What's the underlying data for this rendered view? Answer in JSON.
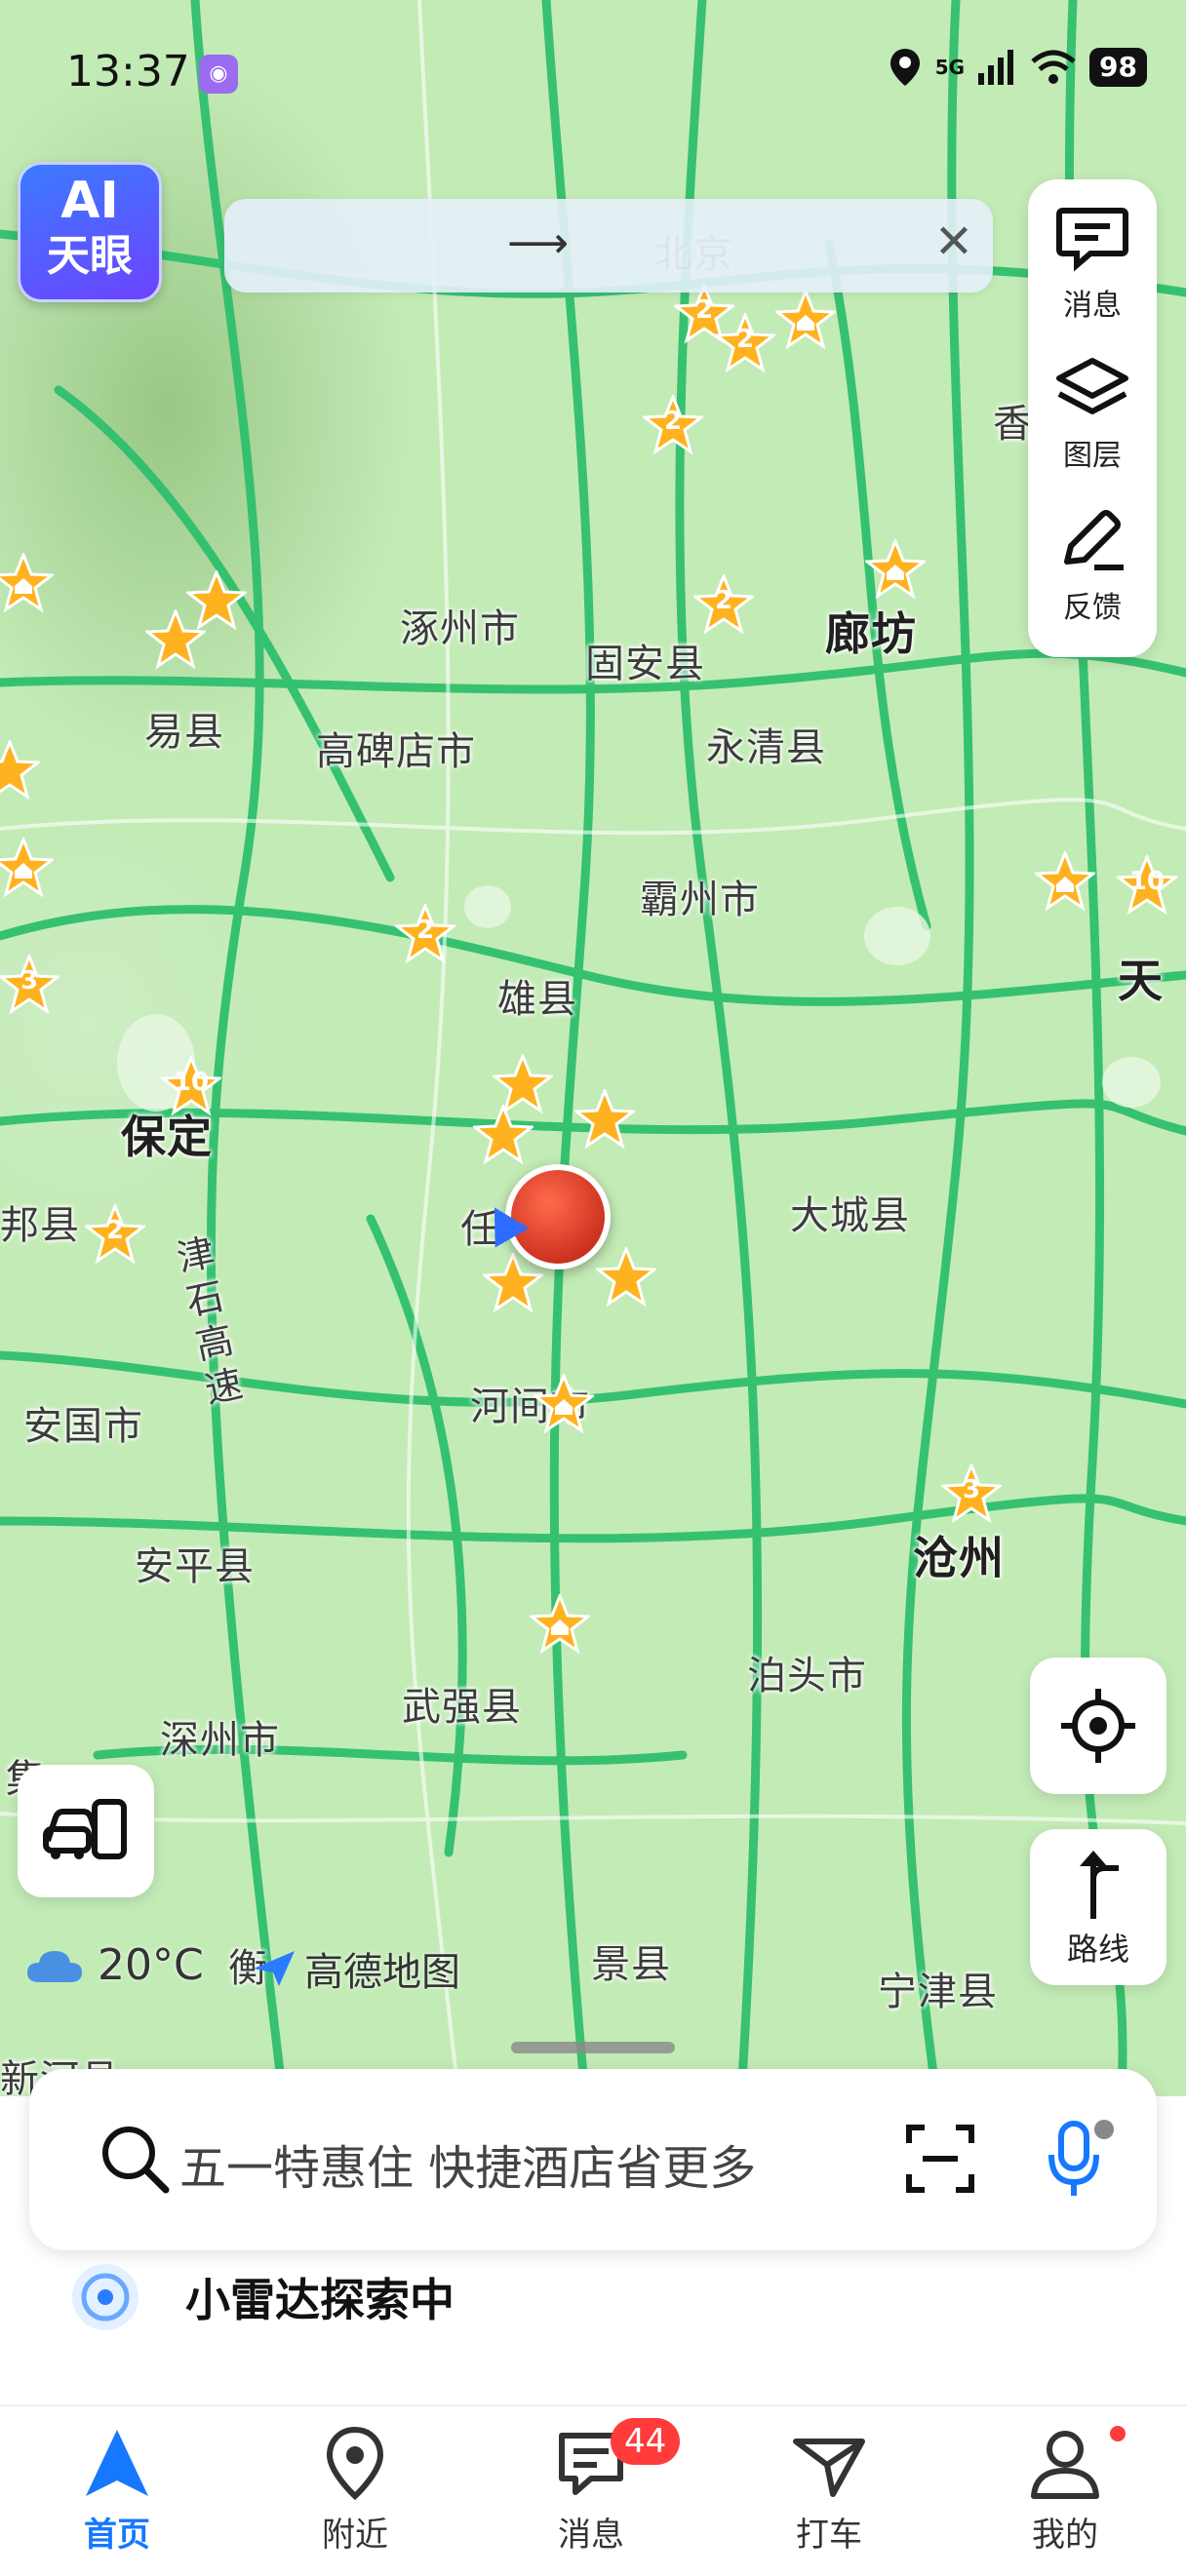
{
  "status_bar": {
    "time": "13:37",
    "network": "5G",
    "battery": "98"
  },
  "ai_badge": {
    "line1": "AI",
    "line2": "天眼"
  },
  "top_bar": {
    "arrow": "⟶"
  },
  "right_panel": [
    {
      "label": "消息",
      "icon": "message-icon"
    },
    {
      "label": "图层",
      "icon": "layers-icon"
    },
    {
      "label": "反馈",
      "icon": "edit-icon"
    }
  ],
  "map": {
    "cities": [
      {
        "name": "涿州市"
      },
      {
        "name": "固安县"
      },
      {
        "name": "廊坊"
      },
      {
        "name": "易县"
      },
      {
        "name": "高碑店市"
      },
      {
        "name": "永清县"
      },
      {
        "name": "霸州市"
      },
      {
        "name": "雄县"
      },
      {
        "name": "保定"
      },
      {
        "name": "大城县"
      },
      {
        "name": "安国市"
      },
      {
        "name": "河间市"
      },
      {
        "name": "沧州"
      },
      {
        "name": "安平县"
      },
      {
        "name": "泊头市"
      },
      {
        "name": "武强县"
      },
      {
        "name": "深州市"
      },
      {
        "name": "景县"
      },
      {
        "name": "宁津县"
      },
      {
        "name": "天"
      },
      {
        "name": "香"
      },
      {
        "name": "任"
      },
      {
        "name": "集"
      },
      {
        "name": "衡"
      },
      {
        "name": "邦县"
      },
      {
        "name": "北京"
      },
      {
        "name": "新河县"
      }
    ],
    "highway_label": "津石高速",
    "star_counts": [
      "2",
      "2",
      "2",
      "2",
      "2",
      "10",
      "10",
      "3",
      "2",
      "3"
    ]
  },
  "weather": {
    "temperature": "20°C",
    "icon": "cloud-icon"
  },
  "map_brand": "高德地图",
  "map_buttons": {
    "route_label": "路线"
  },
  "search": {
    "placeholder": "五一特惠住 快捷酒店省更多"
  },
  "radar": {
    "text": "小雷达探索中"
  },
  "nav": [
    {
      "label": "首页",
      "icon": "navigate-icon",
      "active": true
    },
    {
      "label": "附近",
      "icon": "location-pin-icon"
    },
    {
      "label": "消息",
      "icon": "message-icon",
      "badge": "44"
    },
    {
      "label": "打车",
      "icon": "taxi-icon"
    },
    {
      "label": "我的",
      "icon": "user-icon"
    }
  ],
  "colors": {
    "road": "#2fbf6e",
    "star": "#ffb21f",
    "accent": "#1677ff",
    "map_bg": "#c3ebb6"
  }
}
